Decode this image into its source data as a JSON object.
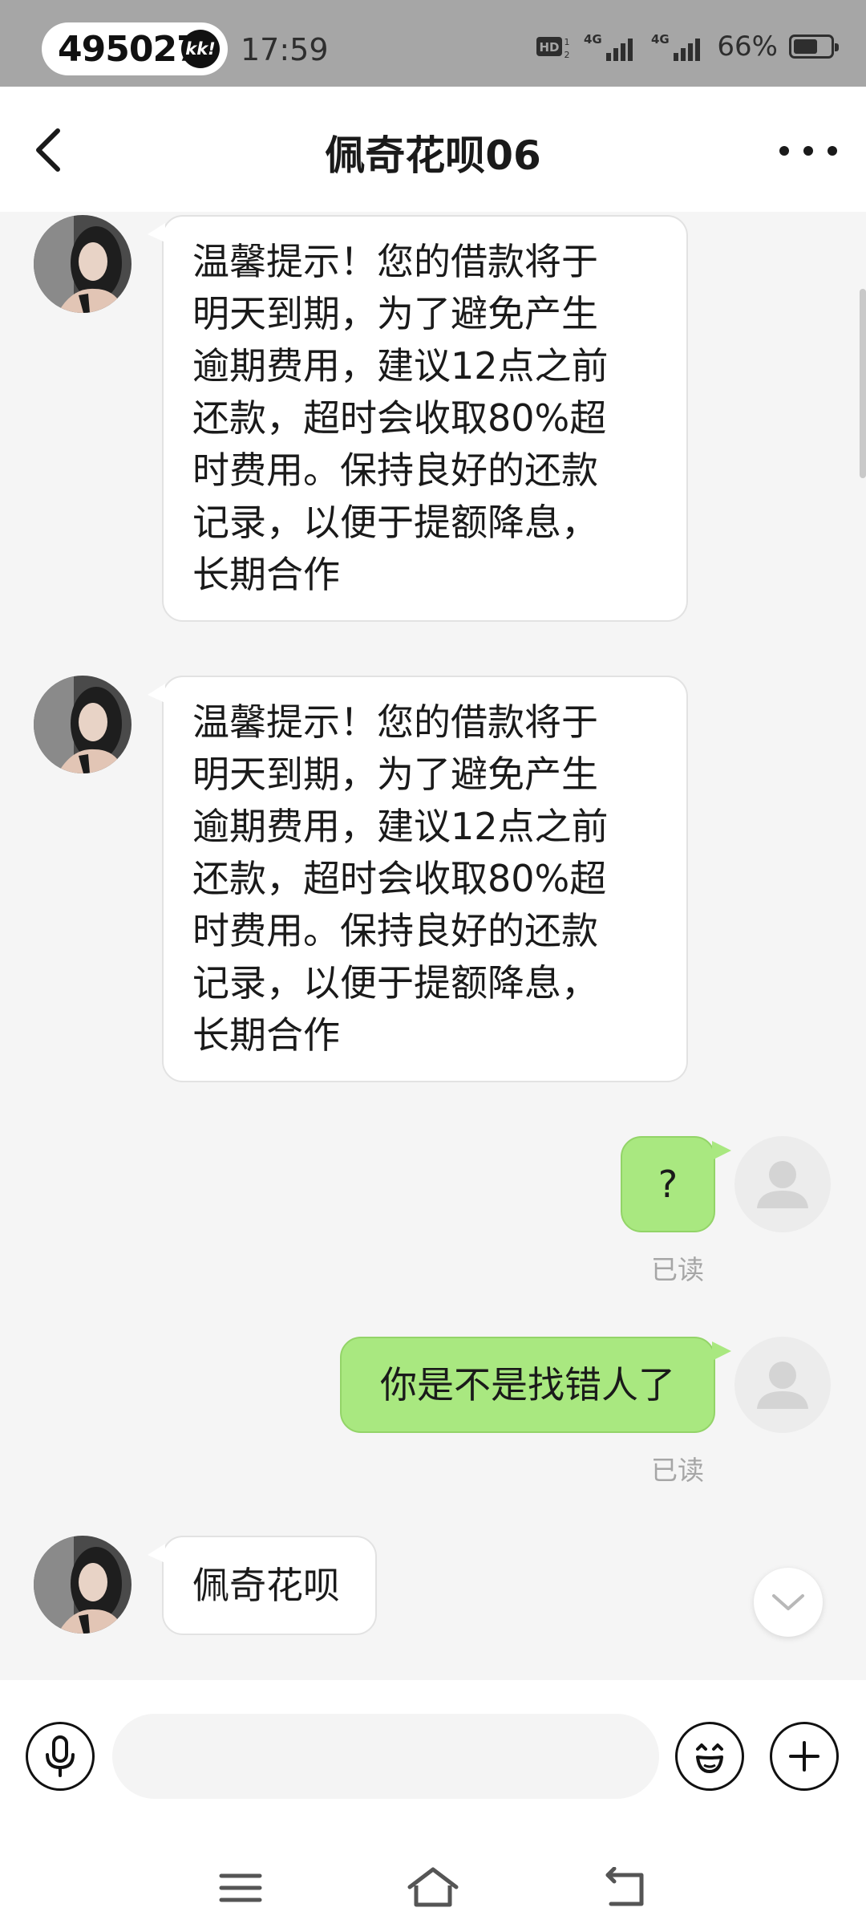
{
  "status_bar": {
    "notification_number": "495027",
    "notification_badge": "kk!",
    "time": "17:59",
    "hd_label": "HD",
    "network_1": "4G",
    "network_2": "4G",
    "battery_percent": "66%",
    "battery_level": 0.66
  },
  "header": {
    "title": "佩奇花呗06"
  },
  "messages": [
    {
      "side": "left",
      "lines": [
        "温馨提示！您的借款将于",
        "明天到期，为了避免产生",
        "逾期费用，建议12点之前",
        "还款，超时会收取80%超",
        "时费用。保持良好的还款",
        "记录，以便于提额降息，",
        "长期合作"
      ]
    },
    {
      "side": "left",
      "lines": [
        "温馨提示！您的借款将于",
        "明天到期，为了避免产生",
        "逾期费用，建议12点之前",
        "还款，超时会收取80%超",
        "时费用。保持良好的还款",
        "记录，以便于提额降息，",
        "长期合作"
      ]
    },
    {
      "side": "right",
      "text": "?",
      "status": "已读"
    },
    {
      "side": "right",
      "text": "你是不是找错人了",
      "status": "已读"
    },
    {
      "side": "left",
      "text": "佩奇花呗"
    }
  ],
  "input_bar": {
    "placeholder": "",
    "value": ""
  },
  "colors": {
    "status_bar_bg": "#a6a6a6",
    "sent_bubble": "#a9e880",
    "received_bubble": "#ffffff",
    "chat_bg": "#f5f5f5"
  }
}
